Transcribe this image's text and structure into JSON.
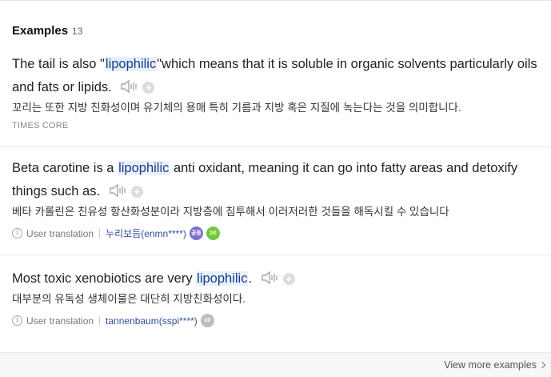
{
  "header": {
    "title": "Examples",
    "count": "13"
  },
  "examples": [
    {
      "en_before": "The tail is also \"",
      "en_highlight": "lipophilic",
      "en_after": "\"which means that it is soluble in organic solvents particularly oils and fats or lipids.",
      "ko": "꼬리는 또한 지방 친화성이며 유기체의 용매 특히 기름과 지방 혹은 지질에 녹는다는 것을 의미합니다.",
      "source": "TIMES CORE"
    },
    {
      "en_before": "Beta carotine is a ",
      "en_highlight": "lipophilic",
      "en_after": " anti oxidant, meaning it can go into fatty areas and detoxify things such as.",
      "ko": "베타 카롤린은 친유성 항산화성분이라 지방층에 침투해서 이러저러한 것들을 해독시킬 수 있습니다",
      "meta_label": "User translation",
      "user": "누리보듬(enmn****)",
      "badges": [
        "공동",
        "1K"
      ]
    },
    {
      "en_before": "Most toxic xenobiotics are very ",
      "en_highlight": "lipophilic",
      "en_after": ".",
      "ko": "대부분의 유독성 생체이물은 대단히 지방친화성이다.",
      "meta_label": "User translation",
      "user": "tannenbaum(sspi****)",
      "badges": [
        "10"
      ]
    }
  ],
  "footer": {
    "more_label": "View more examples"
  },
  "icons": {
    "speaker": "speaker-icon",
    "add": "plus-circle-icon",
    "info": "info-icon",
    "chevron": "chevron-right-icon"
  },
  "colors": {
    "highlight_bg": "#e6f1fc",
    "user_link": "#2f4f9a",
    "badge_purple": "#7b6fd0",
    "badge_green": "#74c93b"
  }
}
